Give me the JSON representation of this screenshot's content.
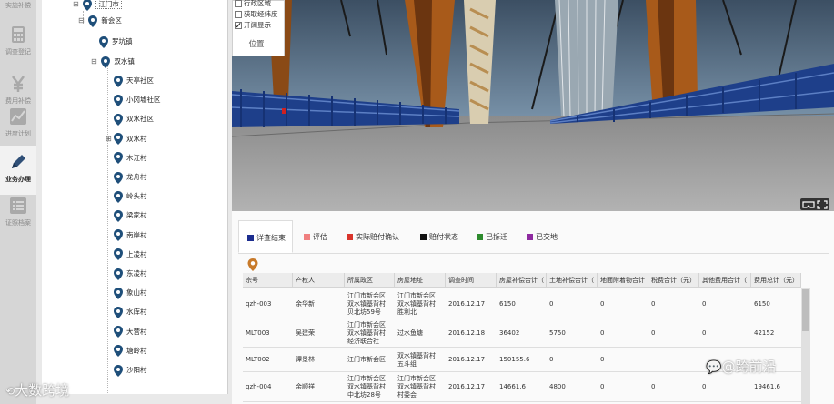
{
  "sidebar": {
    "items": [
      {
        "label": "实施补偿"
      },
      {
        "label": "调查登记"
      },
      {
        "label": "费用补偿"
      },
      {
        "label": "进度计划"
      },
      {
        "label": "业务办理"
      },
      {
        "label": "证照档案"
      }
    ]
  },
  "tree": {
    "root": "江门市",
    "district": "新会区",
    "towns": [
      "罗坑镇",
      "双水镇"
    ],
    "villages": [
      "天亭社区",
      "小冈墟社区",
      "双水社区",
      "双水村",
      "木江村",
      "龙舟村",
      "岭头村",
      "梁家村",
      "南岸村",
      "上凌村",
      "东凌村",
      "象山村",
      "水库村",
      "大营村",
      "塘岭村",
      "沙阳村"
    ]
  },
  "layers": {
    "items": [
      {
        "label": "行政区域",
        "checked": false
      },
      {
        "label": "获取经纬度",
        "checked": false
      },
      {
        "label": "开阔显示",
        "checked": true
      }
    ],
    "position_button": "位置"
  },
  "tabs": [
    {
      "label": "详查结束",
      "color": "#1c2d8f"
    },
    {
      "label": "评估",
      "color": "#f08080"
    },
    {
      "label": "实际赔付确认",
      "color": "#d9342b"
    },
    {
      "label": "赔付状态",
      "color": "#111111"
    },
    {
      "label": "已拆迁",
      "color": "#2e8b2e"
    },
    {
      "label": "已交地",
      "color": "#8e2aa0"
    }
  ],
  "table": {
    "columns": [
      "宗号",
      "产权人",
      "所属政区",
      "房屋地址",
      "调查时间",
      "房屋补偿合计（",
      "土地补偿合计（",
      "地面附着物合计",
      "税费合计（元）",
      "其他费用合计（",
      "费用总计（元）"
    ],
    "rows": [
      [
        "qzh-003",
        "余华新",
        "江门市新会区\n双水镇基背村\n贝北坊59号",
        "江门市新会区\n双水镇基背村\n胜利北",
        "2016.12.17",
        "6150",
        "0",
        "0",
        "0",
        "0",
        "6150"
      ],
      [
        "MLT003",
        "吴建荣",
        "江门市新会区\n双水镇基背村\n经济联合社",
        "过水鱼塘",
        "2016.12.18",
        "36402",
        "5750",
        "0",
        "0",
        "0",
        "42152"
      ],
      [
        "MLT002",
        "谭景林",
        "江门市新会区",
        "双水镇基背村\n五斗组",
        "2016.12.17",
        "150155.6",
        "0",
        "0",
        "",
        "",
        ""
      ],
      [
        "qzh-004",
        "余顺祥",
        "江门市新会区\n双水镇基背村\n中北坊28号",
        "江门市新会区\n双水镇基背村\n村委会",
        "2016.12.17",
        "14661.6",
        "4800",
        "0",
        "0",
        "0",
        "19461.6"
      ]
    ]
  },
  "watermarks": {
    "left": "大数跨境",
    "right": "@跨前沿"
  }
}
